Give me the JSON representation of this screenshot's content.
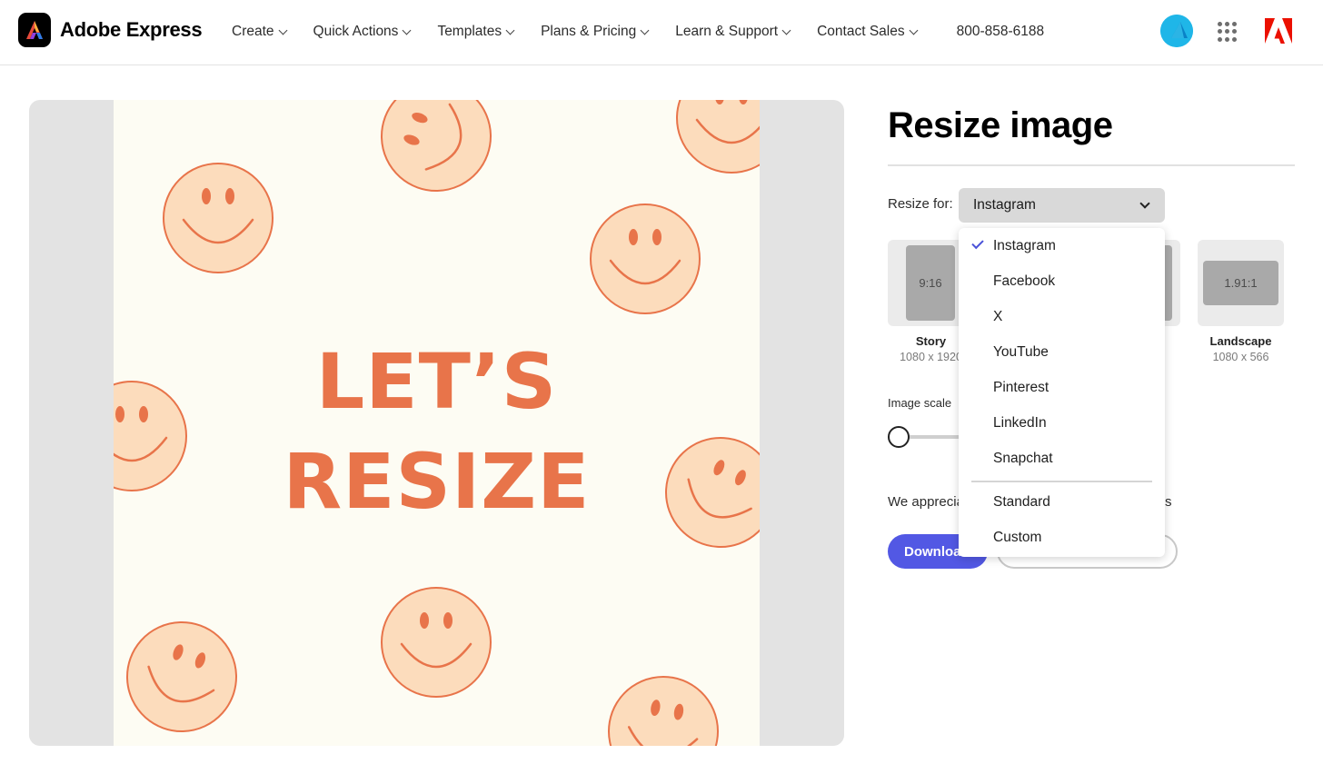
{
  "header": {
    "brand": "Adobe Express",
    "nav": [
      "Create",
      "Quick Actions",
      "Templates",
      "Plans & Pricing",
      "Learn & Support",
      "Contact Sales"
    ],
    "phone": "800-858-6188"
  },
  "canvas": {
    "line1": "LET’S",
    "line2": "RESIZE"
  },
  "panel": {
    "title": "Resize image",
    "resize_for_label": "Resize for:",
    "selected_platform": "Instagram",
    "presets": [
      {
        "ratio": "9:16",
        "name": "Story",
        "dims": "1080 x 1920"
      },
      {
        "ratio": "1.91:1",
        "name": "Landscape",
        "dims": "1080 x 566"
      }
    ],
    "image_scale_label": "Image scale",
    "appreciate_text": "We appreciate",
    "appreciate_tail": "s",
    "download_label": "Download"
  },
  "menu": {
    "items": [
      "Instagram",
      "Facebook",
      "X",
      "YouTube",
      "Pinterest",
      "LinkedIn",
      "Snapchat",
      "Standard",
      "Custom"
    ],
    "checked": "Instagram"
  },
  "colors": {
    "accent": "#5258e4",
    "artwork_orange": "#e8744a",
    "smiley_fill": "#fcdcbc",
    "artboard_bg": "#fdfcf3"
  }
}
